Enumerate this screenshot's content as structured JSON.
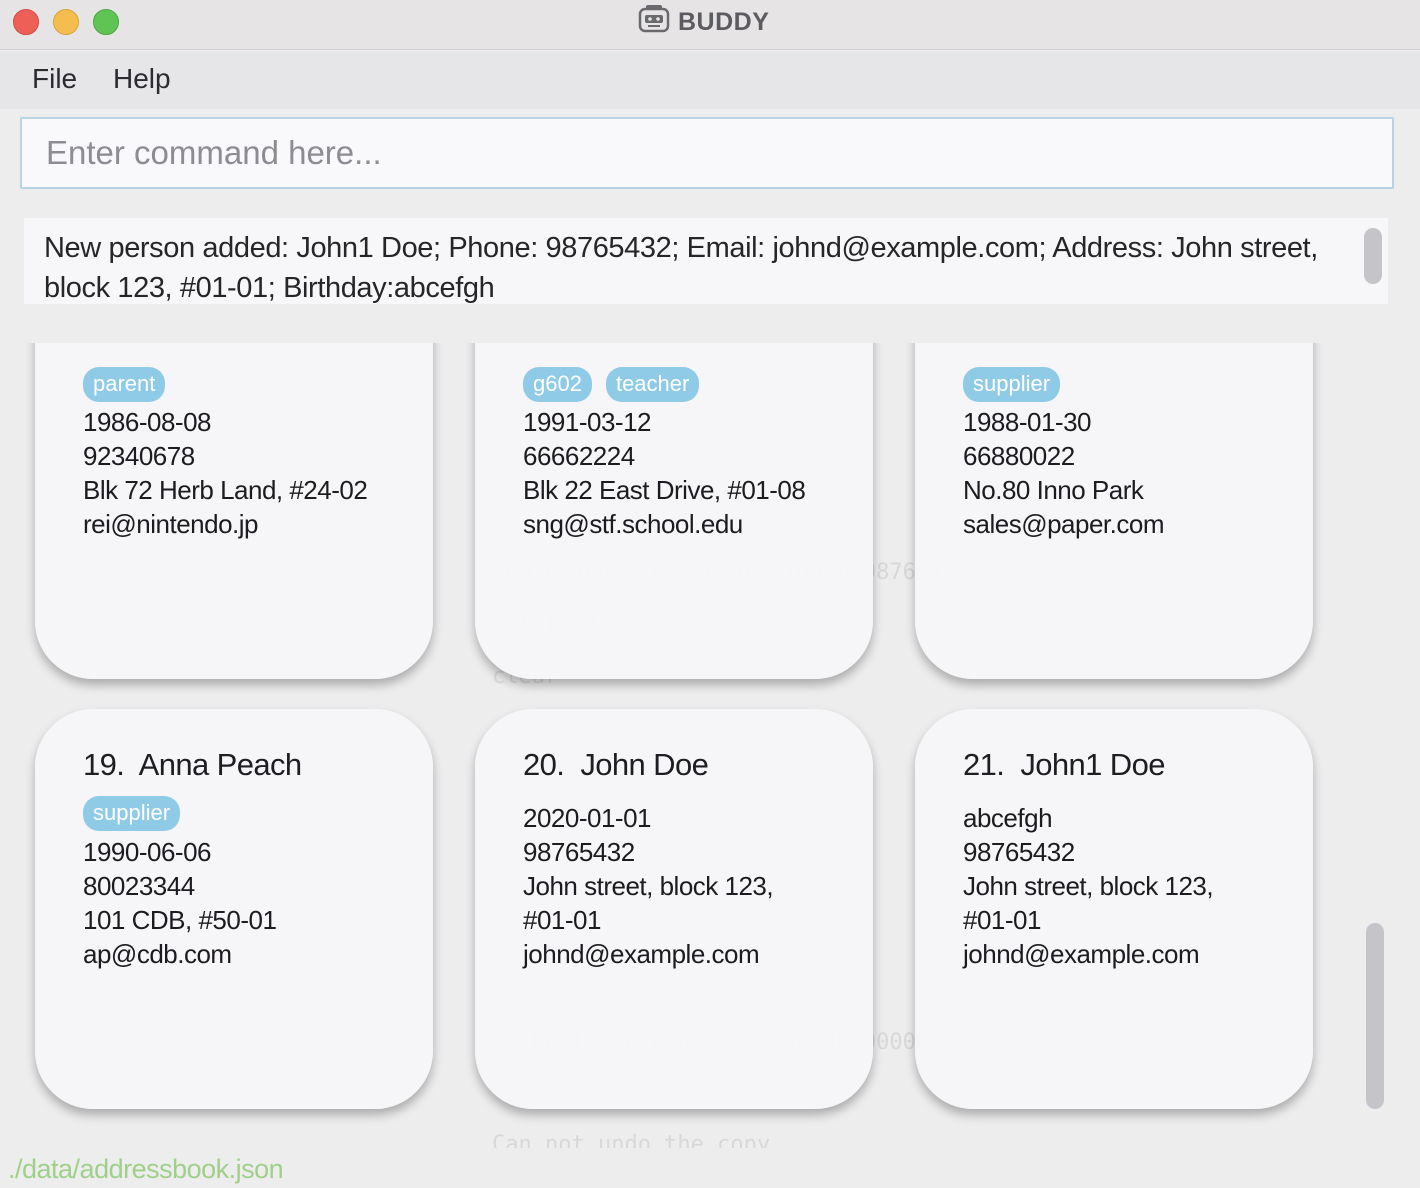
{
  "window": {
    "title": "BUDDY"
  },
  "menu": {
    "file": "File",
    "help": "Help"
  },
  "command": {
    "placeholder": "Enter command here...",
    "value": ""
  },
  "result": {
    "message": "New person added: John1 Doe; Phone: 98765432; Email: johnd@example.com; Address: John street, block 123, #01-01; Birthday:abcefgh"
  },
  "cards_top_row": [
    {
      "tags": [
        "parent"
      ],
      "birthday": "1986-08-08",
      "phone": "92340678",
      "address": "Blk 72 Herb Land, #24-02",
      "email": "rei@nintendo.jp"
    },
    {
      "tags": [
        "g602",
        "teacher"
      ],
      "birthday": "1991-03-12",
      "phone": "66662224",
      "address": "Blk 22 East Drive, #01-08",
      "email": "sng@stf.school.edu"
    },
    {
      "tags": [
        "supplier"
      ],
      "birthday": "1988-01-30",
      "phone": "66880022",
      "address": "No.80 Inno Park",
      "email": "sales@paper.com"
    }
  ],
  "cards_bottom_row": [
    {
      "index": "19.",
      "name": "Anna Peach",
      "tags": [
        "supplier"
      ],
      "birthday": "1990-06-06",
      "phone": "80023344",
      "address_lines": [
        "101 CDB, #50-01"
      ],
      "email": "ap@cdb.com"
    },
    {
      "index": "20.",
      "name": "John Doe",
      "tags": [],
      "birthday": "2020-01-01",
      "phone": "98765432",
      "address_lines": [
        "John street, block 123,",
        "#01-01"
      ],
      "email": "johnd@example.com"
    },
    {
      "index": "21.",
      "name": "John1 Doe",
      "tags": [],
      "birthday": "abcefgh",
      "phone": "98765432",
      "address_lines": [
        "John street, block 123,",
        "#01-01"
      ],
      "email": "johnd@example.com"
    }
  ],
  "status": {
    "path": "./data/addressbook.json"
  },
  "colors": {
    "tag": "#8fcbe6",
    "status_path": "#9fd08a",
    "command_border": "#b7d3e6"
  }
}
